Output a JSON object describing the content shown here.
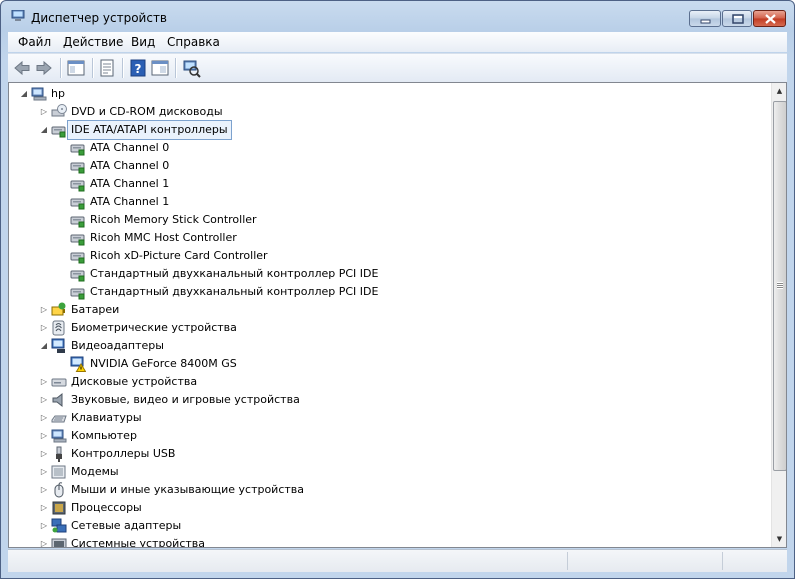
{
  "window": {
    "title": "Диспетчер устройств"
  },
  "menu": [
    {
      "label": "Файл"
    },
    {
      "label": "Действие"
    },
    {
      "label": "Вид"
    },
    {
      "label": "Справка"
    }
  ],
  "toolbar": {
    "buttons": [
      "back-icon",
      "forward-icon",
      "console-tree-icon",
      "properties-icon",
      "help-icon",
      "show-hide-icon",
      "scan-hardware-icon"
    ]
  },
  "tree": {
    "root": {
      "label": "hp",
      "expanded": true
    },
    "items": [
      {
        "label": "DVD и CD-ROM дисководы",
        "icon": "dvd-drive-icon",
        "level": 1,
        "expanded": false
      },
      {
        "label": "IDE ATA/ATAPI контроллеры",
        "icon": "ide-controller-icon",
        "level": 1,
        "expanded": true,
        "selected": true
      },
      {
        "label": "ATA Channel 0",
        "icon": "ide-controller-icon",
        "level": 2
      },
      {
        "label": "ATA Channel 0",
        "icon": "ide-controller-icon",
        "level": 2
      },
      {
        "label": "ATA Channel 1",
        "icon": "ide-controller-icon",
        "level": 2
      },
      {
        "label": "ATA Channel 1",
        "icon": "ide-controller-icon",
        "level": 2
      },
      {
        "label": "Ricoh Memory Stick Controller",
        "icon": "ide-controller-icon",
        "level": 2
      },
      {
        "label": "Ricoh MMC Host Controller",
        "icon": "ide-controller-icon",
        "level": 2
      },
      {
        "label": "Ricoh xD-Picture Card Controller",
        "icon": "ide-controller-icon",
        "level": 2
      },
      {
        "label": "Стандартный двухканальный контроллер PCI IDE",
        "icon": "ide-controller-icon",
        "level": 2
      },
      {
        "label": "Стандартный двухканальный контроллер PCI IDE",
        "icon": "ide-controller-icon",
        "level": 2
      },
      {
        "label": "Батареи",
        "icon": "battery-icon",
        "level": 1,
        "expanded": false
      },
      {
        "label": "Биометрические устройства",
        "icon": "fingerprint-icon",
        "level": 1,
        "expanded": false
      },
      {
        "label": "Видеоадаптеры",
        "icon": "display-adapter-icon",
        "level": 1,
        "expanded": true
      },
      {
        "label": "NVIDIA GeForce 8400M GS",
        "icon": "display-adapter-warning-icon",
        "level": 2
      },
      {
        "label": "Дисковые устройства",
        "icon": "disk-drive-icon",
        "level": 1,
        "expanded": false
      },
      {
        "label": "Звуковые, видео и игровые устройства",
        "icon": "speaker-icon",
        "level": 1,
        "expanded": false
      },
      {
        "label": "Клавиатуры",
        "icon": "keyboard-icon",
        "level": 1,
        "expanded": false
      },
      {
        "label": "Компьютер",
        "icon": "computer-icon",
        "level": 1,
        "expanded": false
      },
      {
        "label": "Контроллеры USB",
        "icon": "usb-icon",
        "level": 1,
        "expanded": false
      },
      {
        "label": "Модемы",
        "icon": "modem-icon",
        "level": 1,
        "expanded": false
      },
      {
        "label": "Мыши и иные указывающие устройства",
        "icon": "mouse-icon",
        "level": 1,
        "expanded": false
      },
      {
        "label": "Процессоры",
        "icon": "processor-icon",
        "level": 1,
        "expanded": false
      },
      {
        "label": "Сетевые адаптеры",
        "icon": "network-adapter-icon",
        "level": 1,
        "expanded": false
      },
      {
        "label": "Системные устройства",
        "icon": "system-devices-icon",
        "level": 1,
        "expanded": false
      }
    ]
  }
}
